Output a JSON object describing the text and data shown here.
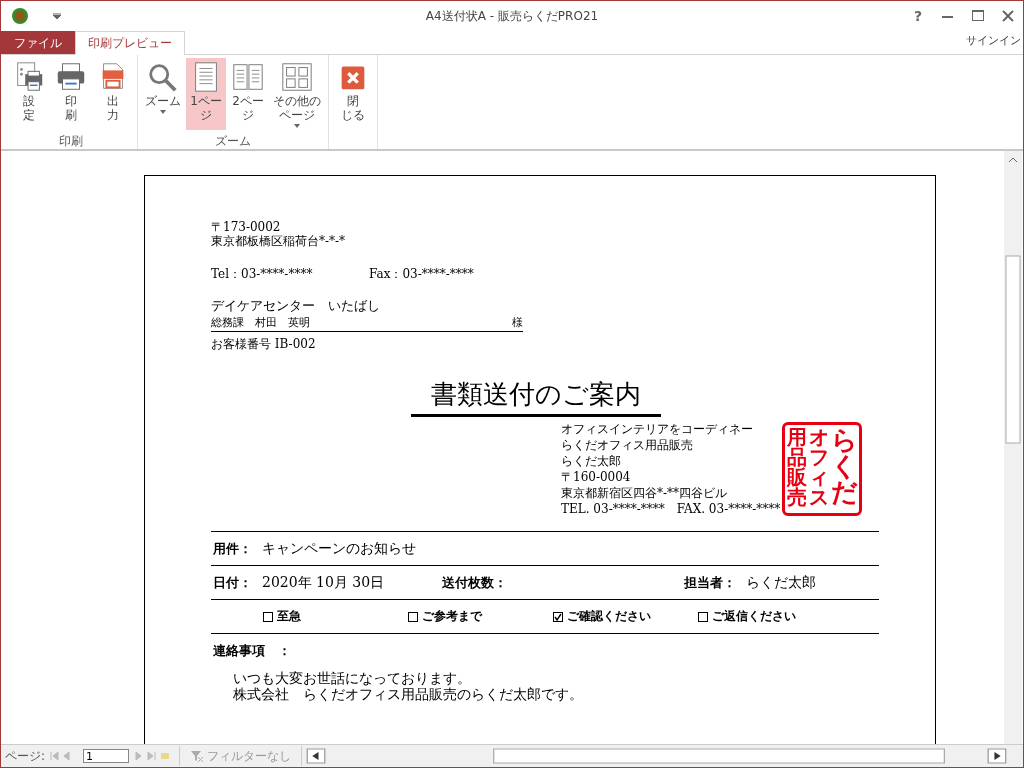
{
  "window": {
    "title": "A4送付状A - 販売らくだPRO21",
    "help": "?"
  },
  "tabs": [
    {
      "label": "ファイル",
      "kind": "file",
      "selected": false
    },
    {
      "label": "印刷プレビュー",
      "kind": "tab",
      "selected": true
    }
  ],
  "account": "サインイン",
  "ribbon": [
    {
      "label": "印刷",
      "buttons": [
        {
          "kind": "setup",
          "lines": [
            "設",
            "定"
          ],
          "selected": false,
          "dropdown": false
        },
        {
          "kind": "print",
          "lines": [
            "印",
            "刷"
          ],
          "selected": false,
          "dropdown": false
        },
        {
          "kind": "pdf",
          "lines": [
            "出",
            "力"
          ],
          "selected": false,
          "dropdown": false
        }
      ]
    },
    {
      "label": "ズーム",
      "buttons": [
        {
          "kind": "zoom",
          "lines": [
            "ズーム"
          ],
          "selected": false,
          "dropdown": true
        },
        {
          "kind": "one",
          "lines": [
            "1ペー",
            "ジ"
          ],
          "selected": true,
          "dropdown": false
        },
        {
          "kind": "two",
          "lines": [
            "2ペー",
            "ジ"
          ],
          "selected": false,
          "dropdown": false
        },
        {
          "kind": "more",
          "lines": [
            "その他の",
            "ページ"
          ],
          "selected": false,
          "dropdown": true
        }
      ]
    },
    {
      "buttons": [
        {
          "kind": "close",
          "lines": [
            "閉",
            "じる"
          ],
          "selected": false,
          "dropdown": false
        }
      ]
    }
  ],
  "document": {
    "recipient_address": [
      "〒173-0002",
      "東京都板橋区稲荷台*-*-*"
    ],
    "tel": "Tel：03-****-****",
    "fax": "Fax：03-****-****",
    "company": "デイケアセンター　いたばし",
    "person": "総務課　村田　英明",
    "honorific": "様",
    "customer_no": "お客様番号  IB-002",
    "title": "書類送付のご案内",
    "sender": [
      "オフィスインテリアをコーディネー",
      "らくだオフィス用品販売",
      "らくだ太郎",
      "〒160-0004",
      "東京都新宿区四谷*-**四谷ビル"
    ],
    "sender_tel": "TEL. 03-****-****",
    "sender_fax": "FAX. 03-****-****",
    "stamp": [
      "用品販売",
      "オフィス",
      "らくだ"
    ],
    "subject_label": "用件：",
    "subject": "キャンペーンのお知らせ",
    "date_label": "日付：",
    "date": "2020年  10月  30日",
    "pages_label": "送付枚数：",
    "staff_label": "担当者：",
    "staff": "らくだ太郎",
    "checks": [
      {
        "label": "至急",
        "checked": false
      },
      {
        "label": "ご参考まで",
        "checked": false
      },
      {
        "label": "ご確認ください",
        "checked": true
      },
      {
        "label": "ご返信ください",
        "checked": false
      }
    ],
    "notes_label": "連絡事項　：",
    "notes": [
      "いつも大変お世話になっております。",
      "株式会社　らくだオフィス用品販売のらくだ太郎です。"
    ]
  },
  "status_bar": {
    "page_label": "ページ:",
    "page": "1",
    "filter": "フィルターなし"
  }
}
